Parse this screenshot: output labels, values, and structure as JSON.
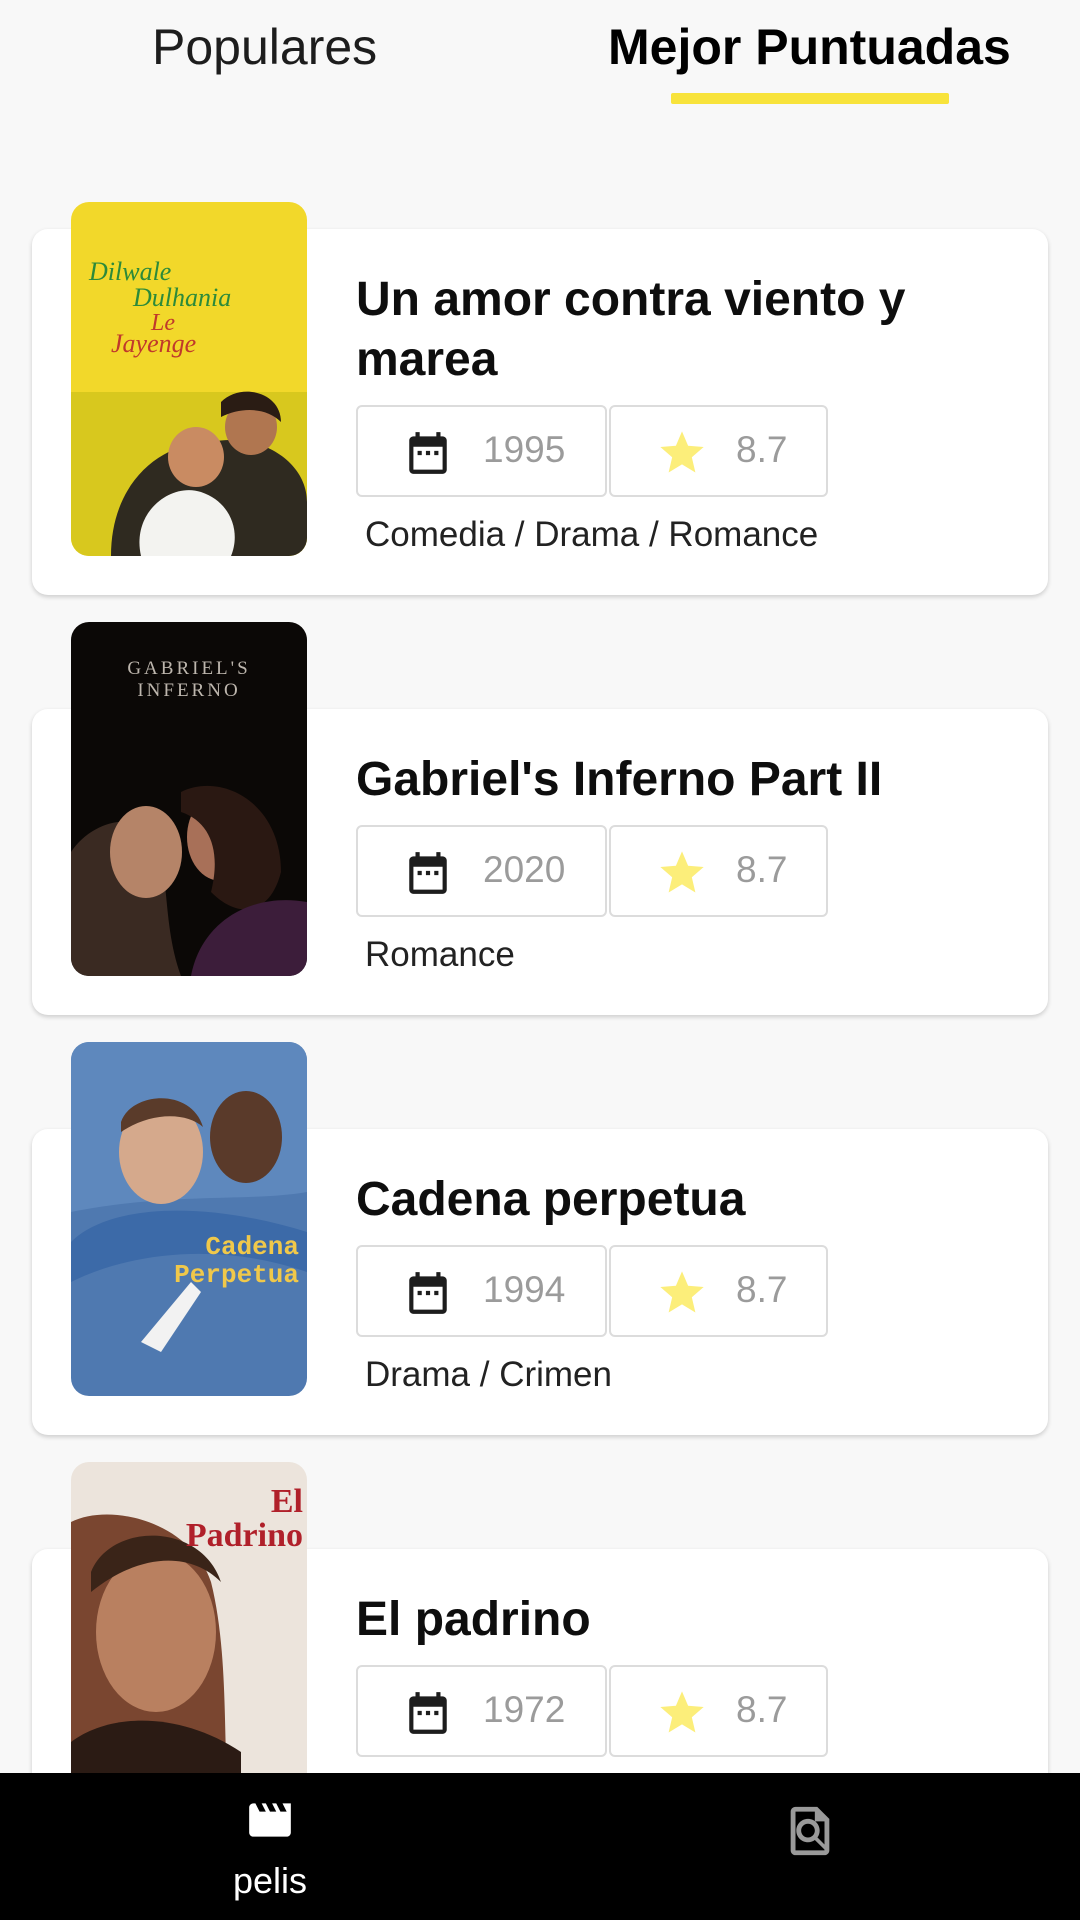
{
  "tabs": [
    {
      "label": "Populares",
      "selected": false
    },
    {
      "label": "Mejor Puntuadas",
      "selected": true
    }
  ],
  "accent_color": "#f8e33b",
  "movies": [
    {
      "title": "Un amor contra viento y marea",
      "year": "1995",
      "rating": "8.7",
      "genres": "Comedia / Drama / Romance",
      "poster_icon": "poster-dilwale-dulhania-le-jayenge",
      "poster_text": [
        "Dilwale",
        "Dulhania",
        "Le",
        "Jayenge"
      ]
    },
    {
      "title": "Gabriel's Inferno Part II",
      "year": "2020",
      "rating": "8.7",
      "genres": "Romance",
      "poster_icon": "poster-gabriels-inferno",
      "poster_text": [
        "GABRIEL'S",
        "INFERNO"
      ]
    },
    {
      "title": "Cadena perpetua",
      "year": "1994",
      "rating": "8.7",
      "genres": "Drama / Crimen",
      "poster_icon": "poster-cadena-perpetua",
      "poster_text": [
        "Cadena",
        "Perpetua"
      ]
    },
    {
      "title": "El padrino",
      "year": "1972",
      "rating": "8.7",
      "genres": "",
      "poster_icon": "poster-el-padrino",
      "poster_text": [
        "El",
        "Padrino"
      ]
    }
  ],
  "bottom_nav": [
    {
      "label": "pelis",
      "icon": "clapperboard-icon",
      "active": true
    },
    {
      "label": "",
      "icon": "search-document-icon",
      "active": false
    }
  ]
}
